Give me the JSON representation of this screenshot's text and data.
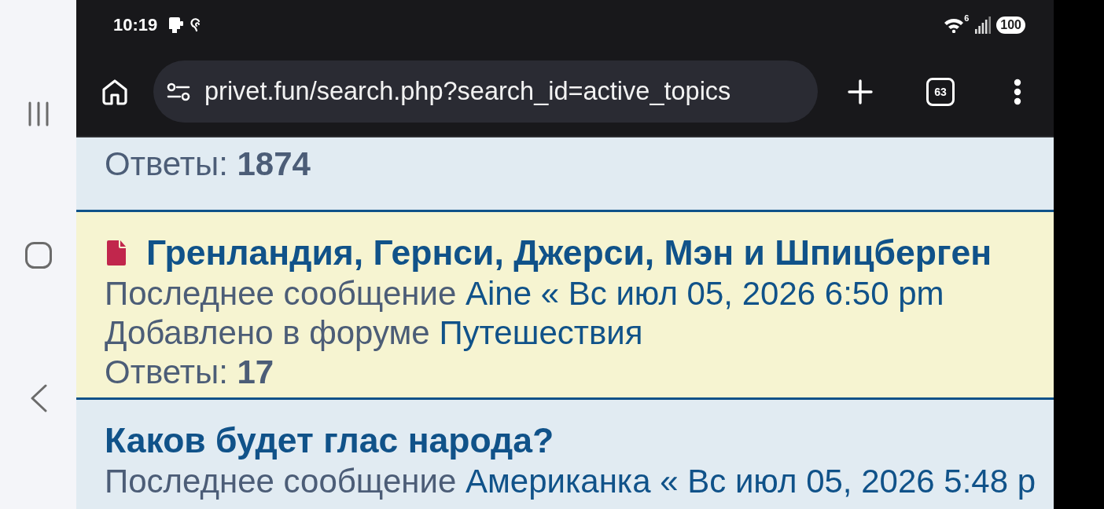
{
  "status_bar": {
    "time": "10:19",
    "wifi_badge": "6",
    "battery": "100"
  },
  "toolbar": {
    "url": "privet.fun/search.php?search_id=active_topics",
    "tab_count": "63"
  },
  "topics": [
    {
      "highlighted": false,
      "replies": "Ответы: **1874**"
    },
    {
      "highlighted": true,
      "unread": true,
      "title": "Гренландия, Гернси, Джерси, Мэн и Шпицберген",
      "last_post_label": "Последнее сообщение",
      "last_post_author": "Aine",
      "last_post_time": "« Вс июл 05, 2026 6:50 pm",
      "forum_label": "Добавлено в форуме",
      "forum": "Путешествия",
      "replies": "Ответы: **17**"
    },
    {
      "highlighted": false,
      "unread": false,
      "title": "Каков будет глас народа?",
      "last_post_label": "Последнее сообщение",
      "last_post_author": "Американка",
      "last_post_time": "« Вс июл 05, 2026 5:48 p"
    }
  ]
}
